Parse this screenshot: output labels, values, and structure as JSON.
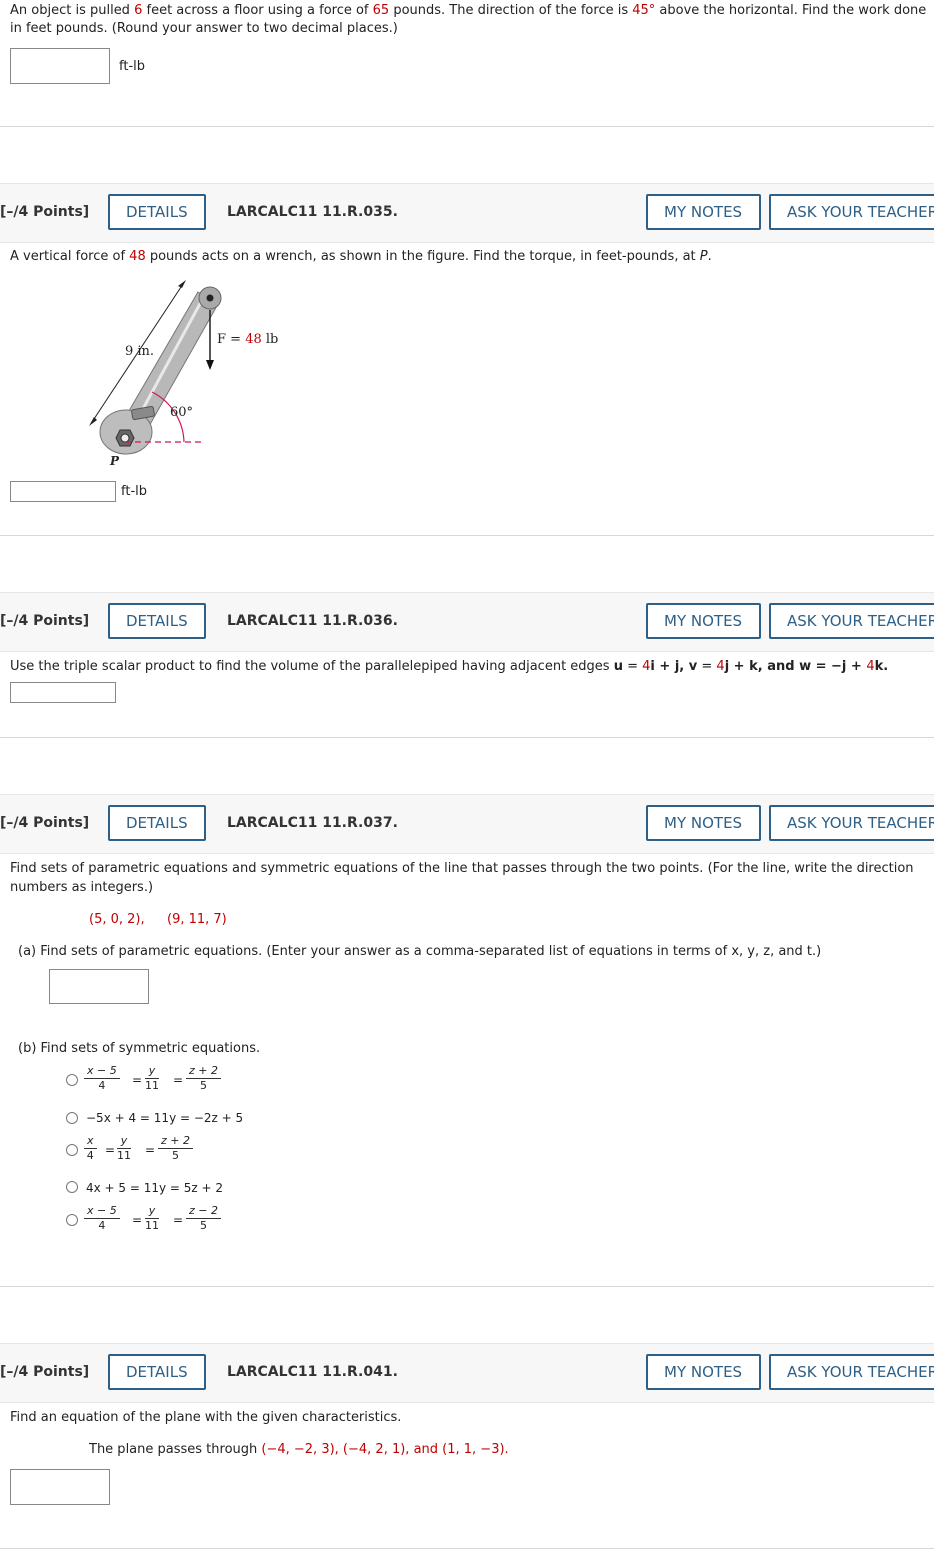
{
  "q1": {
    "text_before_dist": "An object is pulled ",
    "distance": "6",
    "text_before_force": " feet across a floor using a force of ",
    "force": "65",
    "text_before_angle": " pounds. The direction of the force is ",
    "angle": "45°",
    "text_after_angle": " above the horizontal. Find the work done",
    "line2": "in feet pounds. (Round your answer to two decimal places.)",
    "unit": "ft-lb"
  },
  "points_label": "[–/4 Points]",
  "details_label": "DETAILS",
  "my_notes_label": "MY NOTES",
  "ask_teacher_label": "ASK YOUR TEACHER",
  "q2": {
    "code": "LARCALC11 11.R.035.",
    "text_a": "A vertical force of ",
    "force": "48",
    "text_b": " pounds acts on a wrench, as shown in the figure. Find the torque, in feet-pounds, at ",
    "point": "P",
    "text_c": ".",
    "fig_length": "9 in.",
    "fig_force_a": "F = ",
    "fig_force_b": "48",
    "fig_force_c": " lb",
    "fig_angle": "60°",
    "fig_point": "P",
    "unit": "ft-lb"
  },
  "q3": {
    "code": "LARCALC11 11.R.036.",
    "text": "Use the triple scalar product to find the volume of the parallelepiped having adjacent edges ",
    "u": "u",
    "u_eq_a": " = ",
    "u_red": "4",
    "u_eq_b": "i + j, ",
    "v": "v",
    "v_eq_a": " = ",
    "v_red": "4",
    "v_eq_b": "j + k, and ",
    "w": "w",
    "w_eq_a": " = −j + ",
    "w_red": "4",
    "w_eq_b": "k."
  },
  "q4": {
    "code": "LARCALC11 11.R.037.",
    "line1": "Find sets of parametric equations and symmetric equations of the line that passes through the two points. (For the line, write the direction",
    "line2": "numbers as integers.)",
    "p1": "(5, 0, 2),",
    "p2": "(9, 11, 7)",
    "part_a": "(a)  Find sets of parametric equations. (Enter your answer as a comma-separated list of equations in terms of x, y, z, and t.)",
    "part_b": "(b)  Find sets of symmetric equations.",
    "options": {
      "o1": {
        "n1": "x − 5",
        "d1": "4",
        "n2": "y",
        "d2": "11",
        "n3": "z + 2",
        "d3": "5"
      },
      "o2": "−5x + 4 = 11y = −2z + 5",
      "o3": {
        "n1": "x",
        "d1": "4",
        "n2": "y",
        "d2": "11",
        "n3": "z + 2",
        "d3": "5"
      },
      "o4": "4x + 5 = 11y = 5z + 2",
      "o5": {
        "n1": "x − 5",
        "d1": "4",
        "n2": "y",
        "d2": "11",
        "n3": "z − 2",
        "d3": "5"
      }
    },
    "eq_sign": "="
  },
  "q5": {
    "code": "LARCALC11 11.R.041.",
    "line1": "Find an equation of the plane with the given characteristics.",
    "line2_a": "The plane passes through ",
    "pts": "(−4, −2, 3), (−4, 2, 1), and (1, 1, −3)."
  }
}
